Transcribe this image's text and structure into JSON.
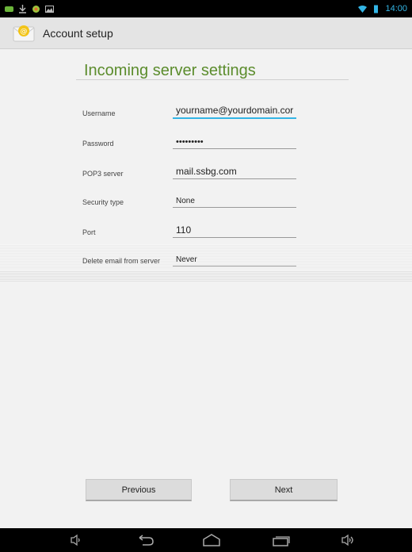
{
  "status_bar": {
    "time": "14:00",
    "icons": [
      "chat-notification-icon",
      "download-icon",
      "android-icon",
      "image-icon",
      "wifi-icon",
      "battery-icon"
    ]
  },
  "action_bar": {
    "title": "Account setup",
    "icon": "email-icon"
  },
  "main": {
    "heading": "Incoming server settings",
    "fields": [
      {
        "label": "Username",
        "value": "yourname@yourdomain.cor",
        "active": true
      },
      {
        "label": "Password",
        "value": "•••••••••"
      },
      {
        "label": "POP3 server",
        "value": "mail.ssbg.com"
      },
      {
        "label": "Security type",
        "value": "None"
      },
      {
        "label": "Port",
        "value": "110"
      },
      {
        "label": "Delete email from server",
        "value": "Never"
      }
    ],
    "buttons": {
      "previous": "Previous",
      "next": "Next"
    }
  },
  "nav_bar": {
    "icons": [
      "volume-down-icon",
      "back-icon",
      "home-icon",
      "recent-apps-icon",
      "volume-up-icon"
    ]
  },
  "colors": {
    "accent": "#33b5e5",
    "heading": "#5b8c2c"
  }
}
